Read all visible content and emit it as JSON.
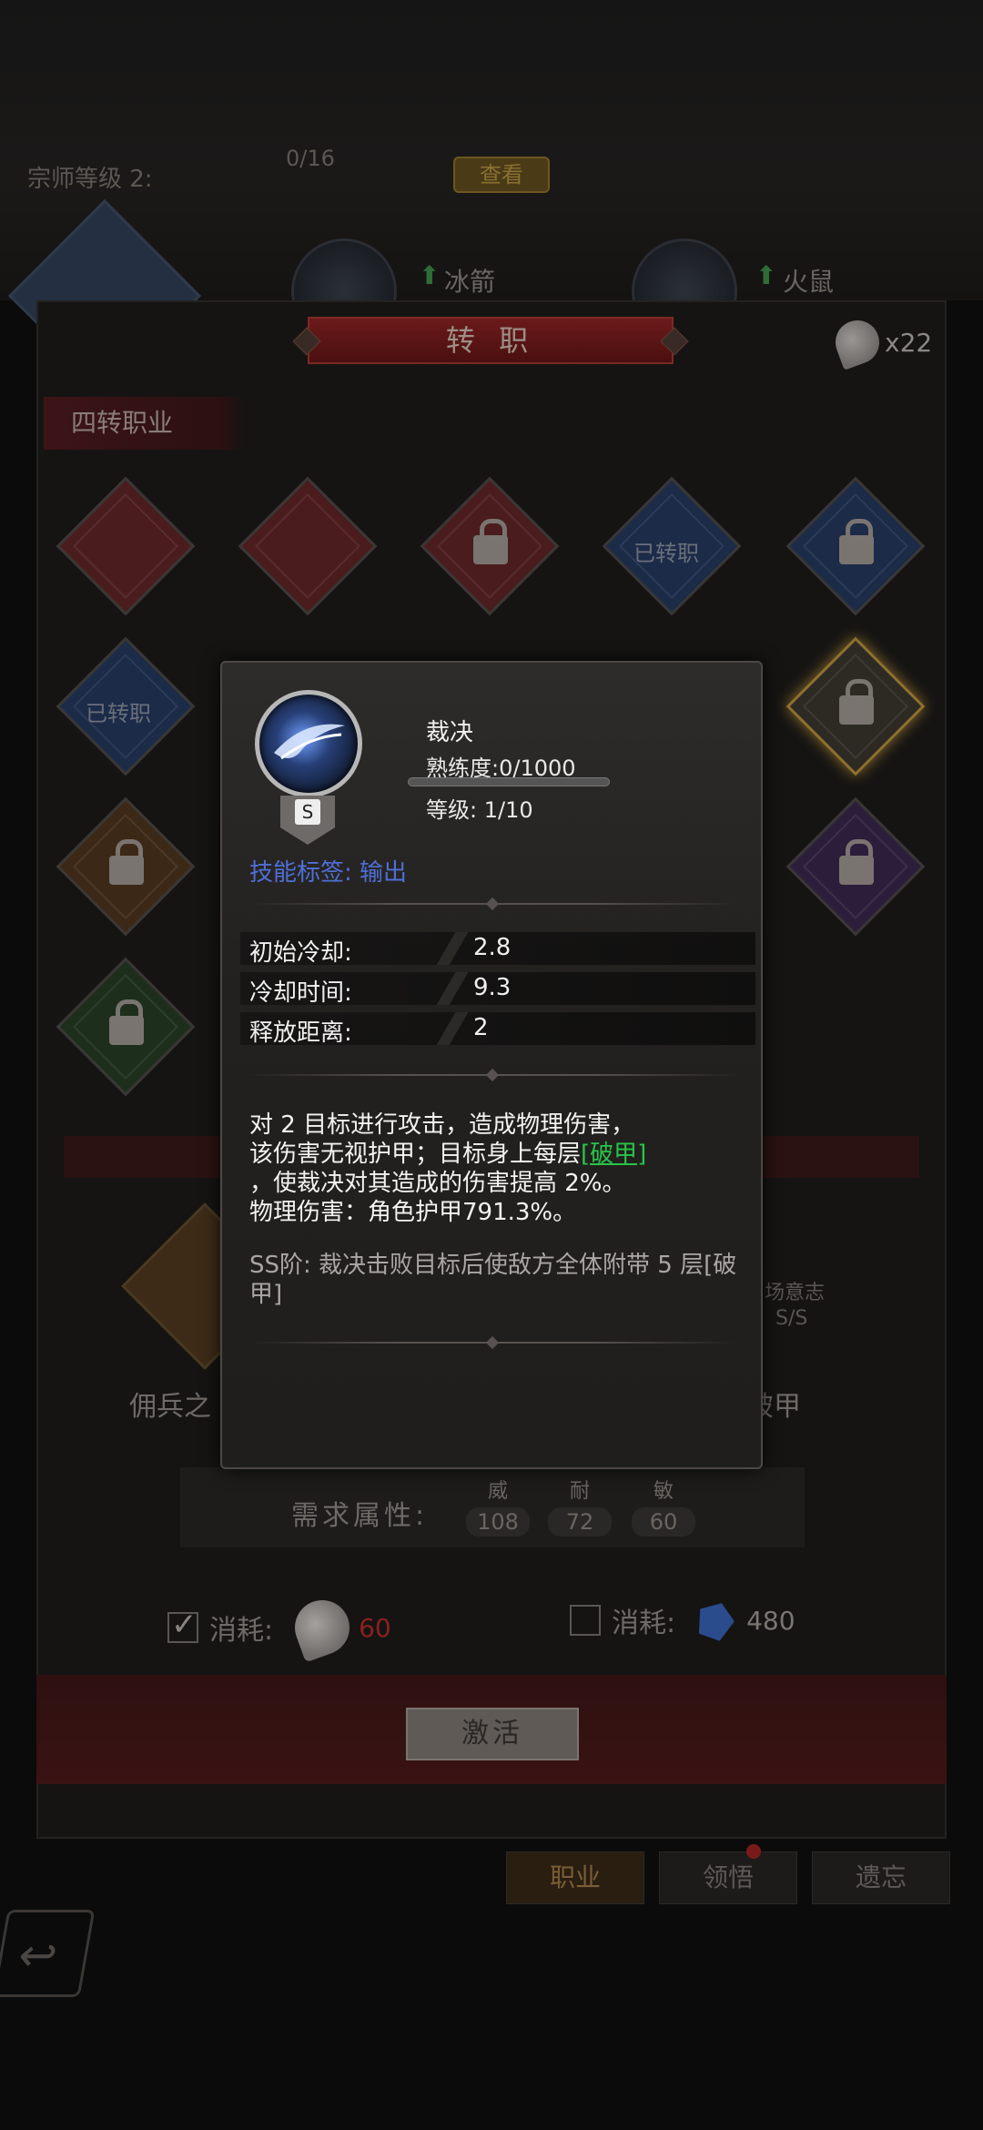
{
  "background": {
    "master_level_label": "宗师等级 2:",
    "master_level_count": "0/16",
    "view_button": "查看",
    "upgrade_labels": [
      "冰箭",
      "火鼠"
    ]
  },
  "header": {
    "title": "转 职",
    "leaf_count": "x22"
  },
  "section": {
    "tab_label": "四转职业"
  },
  "grid": {
    "unlocked_label": "已转职"
  },
  "lower": {
    "left_name": "佣兵之",
    "right_label": "场意志",
    "right_value": "S/S",
    "right_name": "破甲"
  },
  "requirements": {
    "label": "需求属性:",
    "stats": [
      {
        "name": "威",
        "value": "108"
      },
      {
        "name": "耐",
        "value": "72"
      },
      {
        "name": "敏",
        "value": "60"
      }
    ]
  },
  "costs": {
    "label": "消耗:",
    "leaf_amount": "60",
    "gem_amount": "480"
  },
  "activate_label": "激活",
  "bottom_tabs": [
    "职业",
    "领悟",
    "遗忘"
  ],
  "popup": {
    "skill_name": "裁决",
    "proficiency": "熟练度:0/1000",
    "proficiency_fraction": 0,
    "level": "等级: 1/10",
    "grade": "S",
    "tag_label": "技能标签:",
    "tag_value": "输出",
    "stats": [
      {
        "label": "初始冷却:",
        "value": "2.8"
      },
      {
        "label": "冷却时间:",
        "value": "9.3"
      },
      {
        "label": "释放距离:",
        "value": "2"
      }
    ],
    "desc_line1": "对 2 目标进行攻击，造成物理伤害，",
    "desc_line2_pre": "该伤害无视护甲；目标身上每层",
    "desc_keyword": "[破甲]",
    "desc_line3": "，使裁决对其造成的伤害提高 2%。",
    "desc_line4": "物理伤害：角色护甲791.3%。",
    "ss_desc": "SS阶: 裁决击败目标后使敌方全体附带 5 层[破甲]"
  },
  "colors": {
    "accent_red": "#4b0f10",
    "tag_blue": "#4e6fd6",
    "keyword_green": "#28c548",
    "cost_red": "#8a2020"
  }
}
